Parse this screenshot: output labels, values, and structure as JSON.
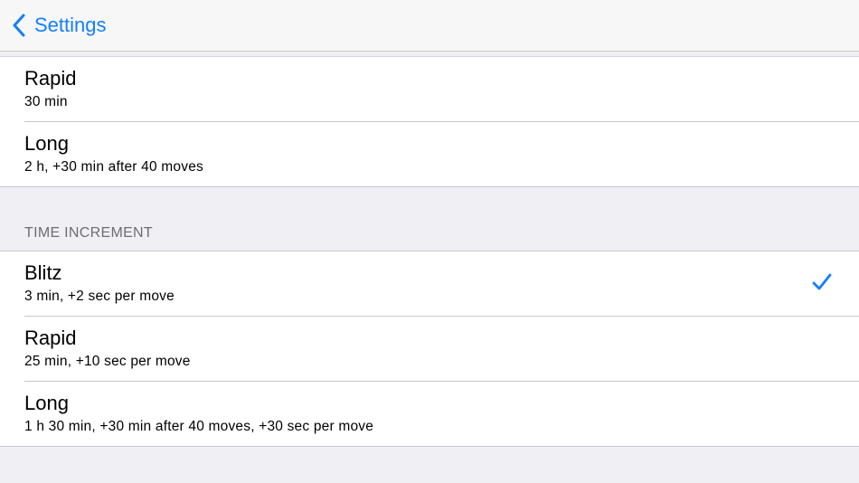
{
  "navbar": {
    "back_label": "Settings",
    "back_icon": "chevron-left-icon",
    "accent_color": "#147efb"
  },
  "section_top": {
    "items": [
      {
        "title": "Rapid",
        "subtitle": "30 min"
      },
      {
        "title": "Long",
        "subtitle": "2 h, +30 min after 40 moves"
      }
    ]
  },
  "section_increment": {
    "header": "TIME INCREMENT",
    "items": [
      {
        "title": "Blitz",
        "subtitle": "3 min, +2 sec per move",
        "selected": true
      },
      {
        "title": "Rapid",
        "subtitle": "25 min, +10 sec per move",
        "selected": false
      },
      {
        "title": "Long",
        "subtitle": "1 h 30 min, +30 min after 40 moves, +30 sec per move",
        "selected": false
      }
    ],
    "selected_icon": "checkmark-icon"
  }
}
